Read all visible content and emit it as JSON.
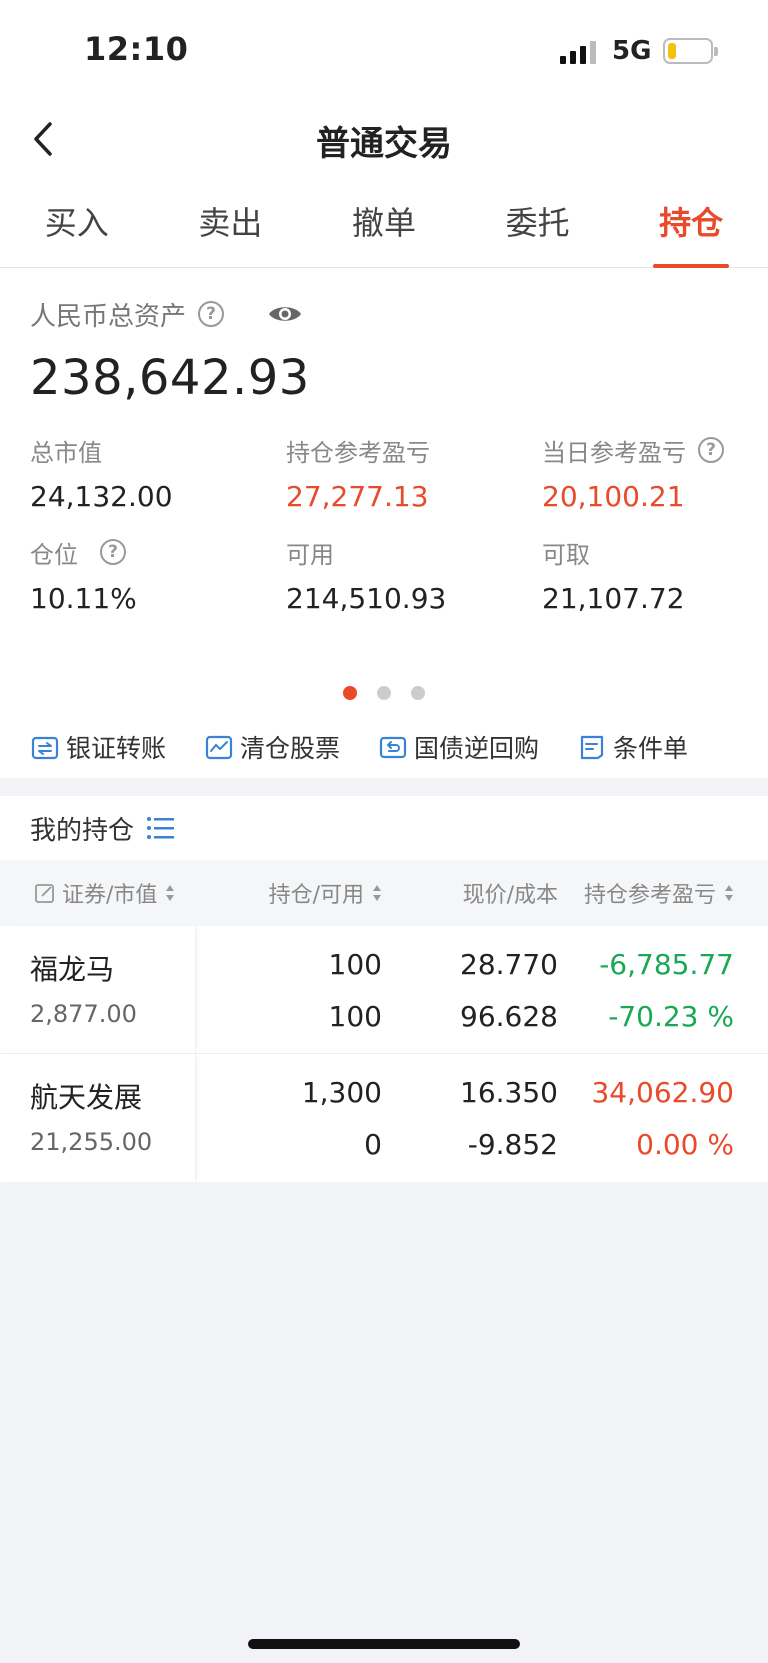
{
  "status_bar": {
    "time": "12:10",
    "network": "5G"
  },
  "header": {
    "title": "普通交易"
  },
  "tabs": [
    {
      "label": "买入",
      "active": false
    },
    {
      "label": "卖出",
      "active": false
    },
    {
      "label": "撤单",
      "active": false
    },
    {
      "label": "委托",
      "active": false
    },
    {
      "label": "持仓",
      "active": true
    }
  ],
  "assets": {
    "total_label": "人民币总资产",
    "total_value": "238,642.93",
    "stats": [
      {
        "label": "总市值",
        "value": "24,132.00",
        "color": "#222222",
        "help": false
      },
      {
        "label": "持仓参考盈亏",
        "value": "27,277.13",
        "color": "#e94a2a",
        "help": false
      },
      {
        "label": "当日参考盈亏",
        "value": "20,100.21",
        "color": "#e94a2a",
        "help": true
      },
      {
        "label": "仓位",
        "value": "10.11%",
        "color": "#222222",
        "help": true
      },
      {
        "label": "可用",
        "value": "214,510.93",
        "color": "#222222",
        "help": false
      },
      {
        "label": "可取",
        "value": "21,107.72",
        "color": "#222222",
        "help": false
      }
    ],
    "page_indicator": {
      "count": 3,
      "active": 1
    }
  },
  "actions": [
    {
      "label": "银证转账",
      "icon": "transfer-icon"
    },
    {
      "label": "清仓股票",
      "icon": "clear-stock-icon"
    },
    {
      "label": "国债逆回购",
      "icon": "repo-icon"
    },
    {
      "label": "条件单",
      "icon": "condition-order-icon"
    }
  ],
  "holdings": {
    "title": "我的持仓",
    "columns": [
      "证券/市值",
      "持仓/可用",
      "现价/成本",
      "持仓参考盈亏"
    ],
    "rows": [
      {
        "name": "福龙马",
        "market_value": "2,877.00",
        "position": "100",
        "available": "100",
        "price": "28.770",
        "cost": "96.628",
        "pnl": "-6,785.77",
        "pnl_pct": "-70.23 %",
        "pnl_color": "#1aa855"
      },
      {
        "name": "航天发展",
        "market_value": "21,255.00",
        "position": "1,300",
        "available": "0",
        "price": "16.350",
        "cost": "-9.852",
        "pnl": "34,062.90",
        "pnl_pct": "0.00 %",
        "pnl_color": "#e94a2a"
      }
    ]
  }
}
